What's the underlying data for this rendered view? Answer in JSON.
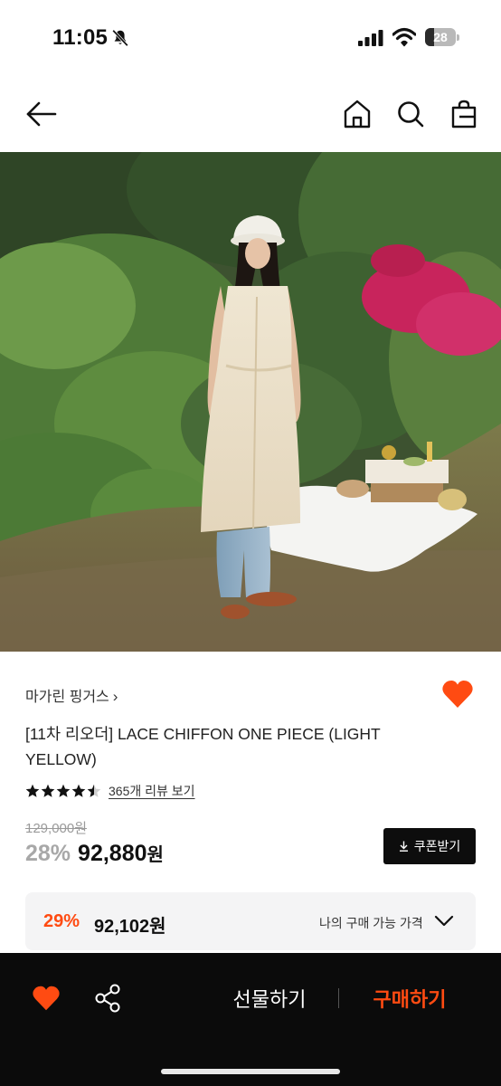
{
  "status_bar": {
    "time": "11:05",
    "mute_icon": "bell-slash-icon",
    "battery_level": "28"
  },
  "nav": {
    "back_icon": "arrow-left-icon",
    "home_icon": "home-icon",
    "search_icon": "search-icon",
    "bag_icon": "shopping-bag-icon"
  },
  "product": {
    "brand": "마가린 핑거스",
    "title": "[11차 리오더] LACE CHIFFON ONE PIECE (LIGHT YELLOW)",
    "rating_stars": 4.5,
    "review_link": "365개 리뷰 보기",
    "original_price": "129,000원",
    "discount_rate": "28%",
    "sale_price": "92,880",
    "sale_price_unit": "원",
    "coupon_button": "쿠폰받기",
    "best_price": {
      "rate": "29%",
      "price": "92,102원",
      "label": "나의 구매 가능 가격"
    }
  },
  "bottom_bar": {
    "gift_label": "선물하기",
    "buy_label": "구매하기"
  },
  "colors": {
    "accent": "#ff4b12",
    "dark": "#0b0b0b",
    "muted": "#a8a8a8",
    "panel": "#f4f4f5"
  }
}
